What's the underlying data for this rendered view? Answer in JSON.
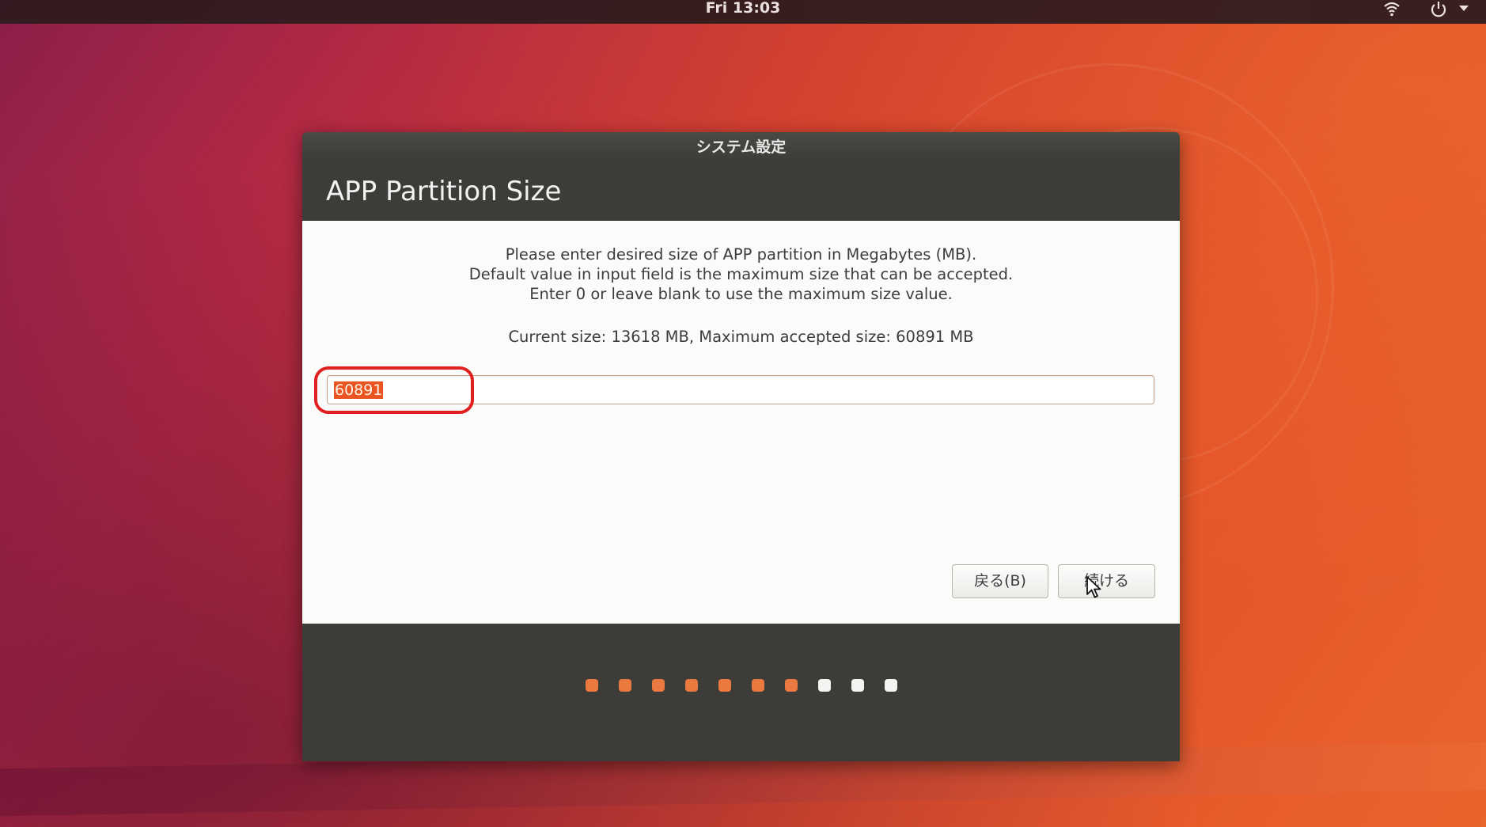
{
  "topbar": {
    "clock": "Fri 13:03",
    "icons": [
      "wifi-icon",
      "power-icon",
      "menu-arrow-icon"
    ]
  },
  "dialog": {
    "window_title": "システム設定",
    "header_title": "APP Partition Size",
    "instructions": [
      "Please enter desired size of APP partition in Megabytes (MB).",
      "Default value in input field is the maximum size that can be accepted.",
      "Enter 0 or leave blank to use the maximum size value."
    ],
    "size_info": "Current size: 13618 MB, Maximum accepted size: 60891 MB",
    "input": {
      "value": "60891",
      "selected": true
    },
    "buttons": {
      "back_label": "戻る(B)",
      "continue_label": "続ける"
    },
    "progress": {
      "total_steps": 10,
      "completed_steps": 7
    }
  },
  "colors": {
    "accent": "#e95420",
    "dialog_dark": "#3d3c38",
    "dot_done": "#e9793f",
    "dot_todo": "#f4f4f2",
    "annotation_circle": "#e01f1f"
  }
}
